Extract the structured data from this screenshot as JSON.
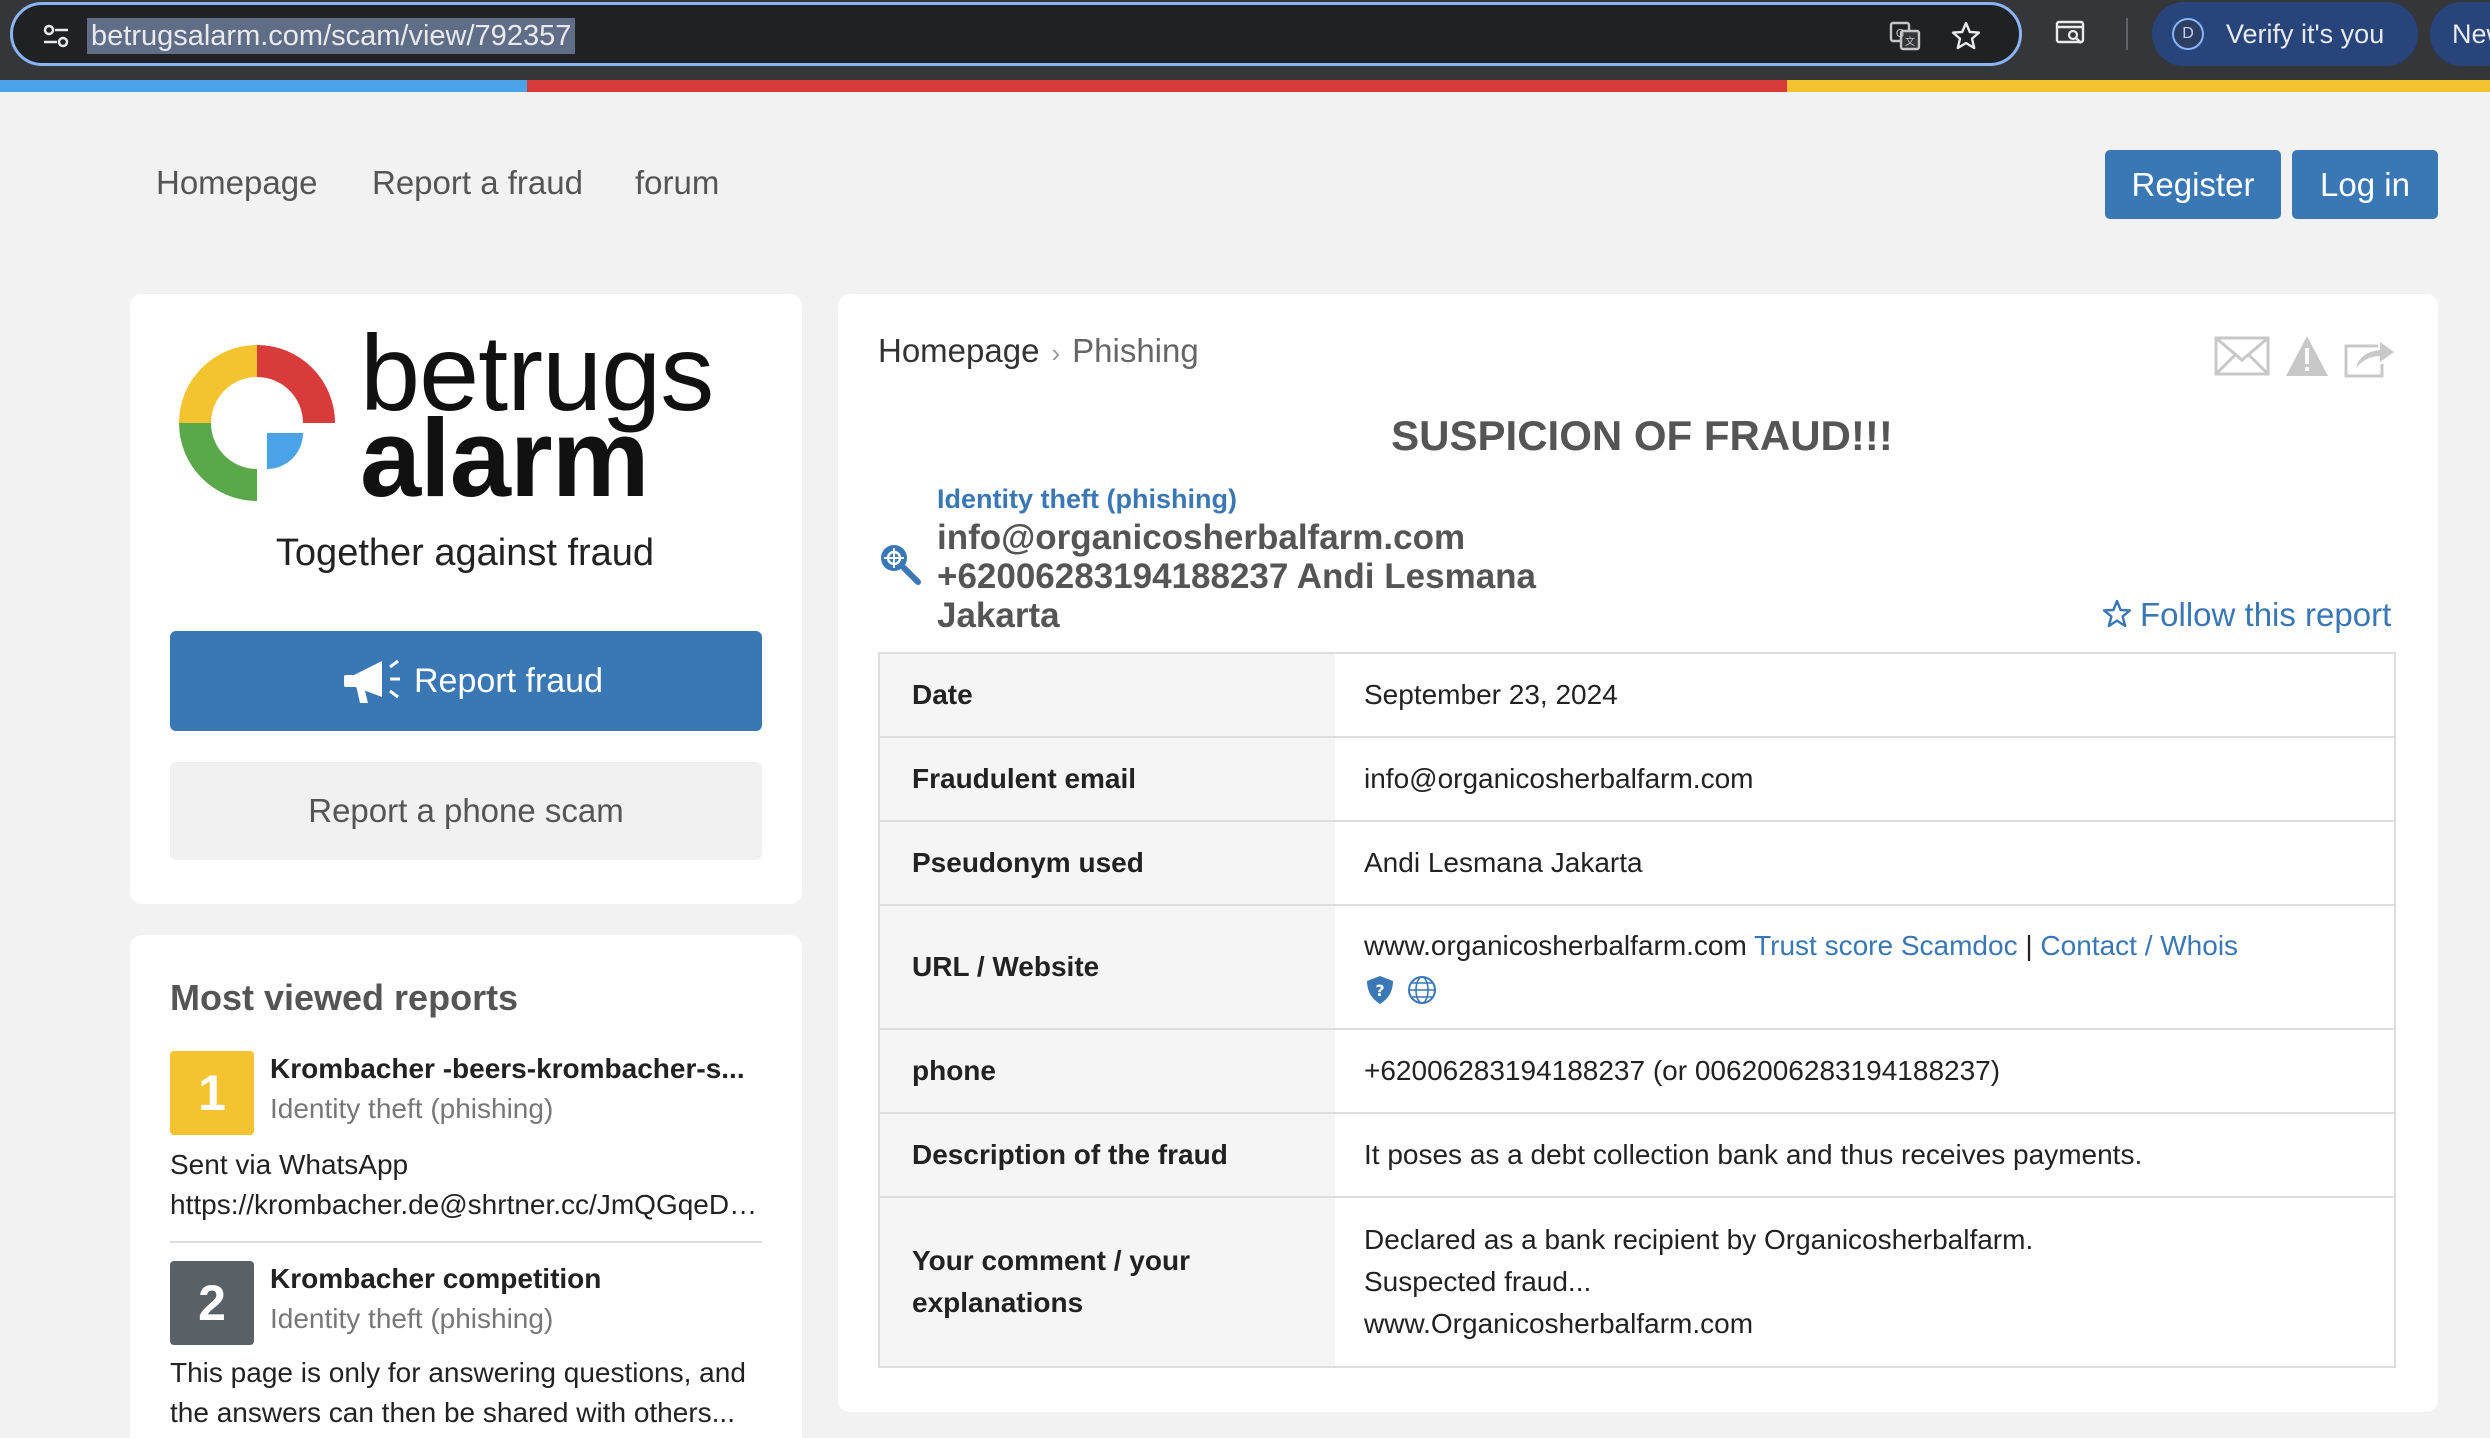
{
  "browser": {
    "url": "betrugsalarm.com/scam/view/792357",
    "verify_label": "Verify it's you",
    "verify_avatar_letter": "D",
    "new_label": "New"
  },
  "stripe_colors": [
    "#4aa3e6",
    "#d93a3a",
    "#f4c430"
  ],
  "nav": {
    "links": [
      "Homepage",
      "Report a fraud",
      "forum"
    ],
    "register_label": "Register",
    "login_label": "Log in"
  },
  "sidebar": {
    "logo_word1": "betrugs",
    "logo_word2": "alarm",
    "slogan": "Together against fraud",
    "report_fraud_label": "Report fraud",
    "phone_scam_label": "Report a phone scam"
  },
  "most_viewed": {
    "title": "Most viewed reports",
    "items": [
      {
        "rank": "1",
        "title": "Krombacher -beers-krombacher-s...",
        "category": "Identity theft (phishing)",
        "desc_line1": "Sent via WhatsApp",
        "desc_line2": "https://krombacher.de@shrtner.cc/JmQGqeDm..."
      },
      {
        "rank": "2",
        "title": "Krombacher competition",
        "category": "Identity theft (phishing)",
        "desc_line1": "This page is only for answering questions, and",
        "desc_line2": "the answers can then be shared with others..."
      }
    ]
  },
  "report": {
    "breadcrumb_home": "Homepage",
    "breadcrumb_current": "Phishing",
    "headline": "SUSPICION OF FRAUD!!!",
    "category": "Identity theft (phishing)",
    "line1": "info@organicosherbalfarm.com",
    "line2": "+62006283194188237 Andi Lesmana",
    "line3": "Jakarta",
    "follow_label": "Follow this report",
    "rows": {
      "date_label": "Date",
      "date_value": "September 23, 2024",
      "email_label": "Fraudulent email",
      "email_value": "info@organicosherbalfarm.com",
      "pseudonym_label": "Pseudonym used",
      "pseudonym_value": "Andi Lesmana Jakarta",
      "url_label": "URL / Website",
      "url_value": "www.organicosherbalfarm.com",
      "url_trust_link": "Trust score Scamdoc",
      "url_sep": "|",
      "url_contact_link": "Contact / Whois",
      "phone_label": "phone",
      "phone_value": "+62006283194188237 (or 0062006283194188237)",
      "description_label": "Description of the fraud",
      "description_value": "It poses as a debt collection bank and thus receives payments.",
      "comment_label_line1": "Your comment / your",
      "comment_label_line2": "explanations",
      "comment_line1": "Declared as a bank recipient by Organicosherbalfarm.",
      "comment_line2": "Suspected fraud...",
      "comment_line3": "www.Organicosherbalfarm.com"
    }
  }
}
